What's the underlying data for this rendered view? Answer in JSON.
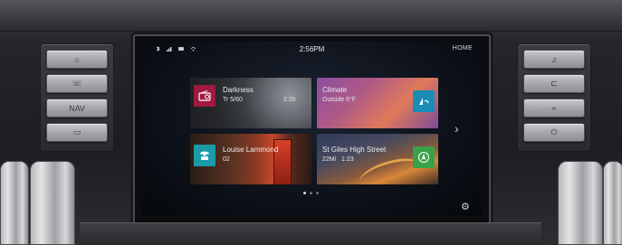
{
  "status_bar": {
    "time": "2:56PM",
    "screen_label": "HOME",
    "icons": [
      "bluetooth-icon",
      "signal-icon",
      "battery-icon",
      "wifi-icon"
    ]
  },
  "tiles": [
    {
      "title": "Darkness",
      "subtitle": "Tr 5/60",
      "extra": "2:35",
      "icon": "media-radio-icon",
      "icon_color": "#a0193f"
    },
    {
      "title": "Climate",
      "subtitle": "Outside 6°F",
      "extra": "",
      "icon": "climate-icon",
      "icon_color": "#1b8cb5"
    },
    {
      "title": "Louise Lammond",
      "subtitle": "02",
      "extra": "",
      "icon": "phone-icon",
      "icon_color": "#1a9ba8"
    },
    {
      "title": "St Giles High Street",
      "subtitle": "22Mi",
      "extra": "1:23",
      "icon": "navigation-icon",
      "icon_color": "#3aa14a"
    }
  ],
  "pager": {
    "pages": 3,
    "active": 1
  },
  "left_buttons": [
    {
      "name": "home",
      "glyph": "⌂"
    },
    {
      "name": "phone",
      "glyph": "☏"
    },
    {
      "name": "nav",
      "glyph": "NAV"
    },
    {
      "name": "media",
      "glyph": "▭"
    }
  ],
  "right_buttons": [
    {
      "name": "audio",
      "glyph": "♫"
    },
    {
      "name": "seat",
      "glyph": "⊏"
    },
    {
      "name": "climate",
      "glyph": "≈"
    },
    {
      "name": "power",
      "glyph": "⏻"
    }
  ]
}
